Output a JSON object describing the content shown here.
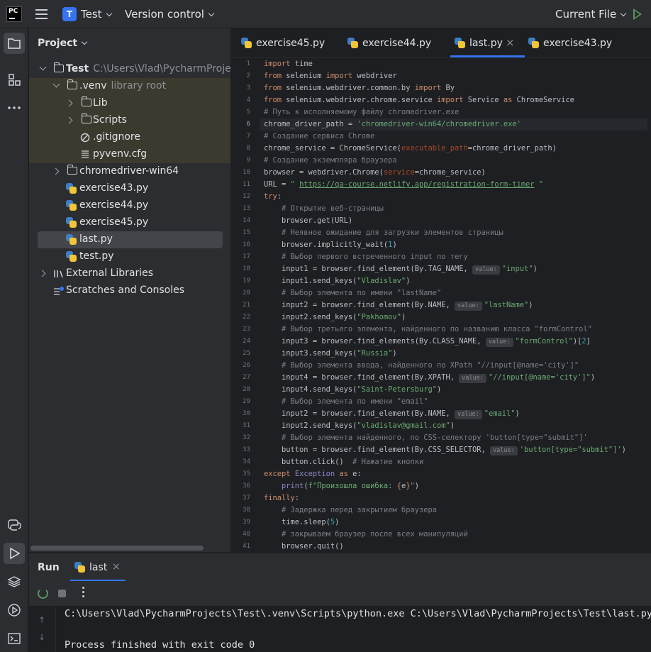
{
  "titlebar": {
    "logo_text": "PC",
    "project_badge": "T",
    "project_name": "Test",
    "vcs_label": "Version control",
    "run_config": "Current File"
  },
  "project_panel": {
    "title": "Project",
    "tree": [
      {
        "label": "Test",
        "sub": "C:\\Users\\Vlad\\PycharmProjects\\Test"
      },
      {
        "label": ".venv",
        "sub": "library root"
      },
      {
        "label": "Lib"
      },
      {
        "label": "Scripts"
      },
      {
        "label": ".gitignore"
      },
      {
        "label": "pyvenv.cfg"
      },
      {
        "label": "chromedriver-win64"
      },
      {
        "label": "exercise43.py"
      },
      {
        "label": "exercise44.py"
      },
      {
        "label": "exercise45.py"
      },
      {
        "label": "last.py"
      },
      {
        "label": "test.py"
      },
      {
        "label": "External Libraries"
      },
      {
        "label": "Scratches and Consoles"
      }
    ]
  },
  "tabs": [
    {
      "label": "exercise45.py"
    },
    {
      "label": "exercise44.py"
    },
    {
      "label": "last.py",
      "close": "×"
    },
    {
      "label": "exercise43.py"
    }
  ],
  "editor": {
    "line_numbers": [
      "1",
      "2",
      "3",
      "4",
      "5",
      "6",
      "7",
      "8",
      "9",
      "10",
      "11",
      "12",
      "13",
      "14",
      "15",
      "16",
      "17",
      "18",
      "19",
      "20",
      "21",
      "22",
      "23",
      "24",
      "25",
      "26",
      "27",
      "28",
      "29",
      "30",
      "31",
      "32",
      "33",
      "34",
      "35",
      "36",
      "37",
      "38",
      "39",
      "40",
      "41"
    ],
    "current_line": 6,
    "hint_label": "value:"
  },
  "run": {
    "title": "Run",
    "tab_label": "last",
    "tab_close": "×",
    "console_lines": [
      "C:\\Users\\Vlad\\PycharmProjects\\Test\\.venv\\Scripts\\python.exe C:\\Users\\Vlad\\PycharmProjects\\Test\\last.py",
      "",
      "Process finished with exit code 0"
    ]
  },
  "colors": {
    "accent": "#3574f0",
    "run_green": "#57965c",
    "keyword": "#cf8e6d",
    "string": "#6aab73",
    "comment": "#7a7e85",
    "number": "#2aacb8"
  }
}
